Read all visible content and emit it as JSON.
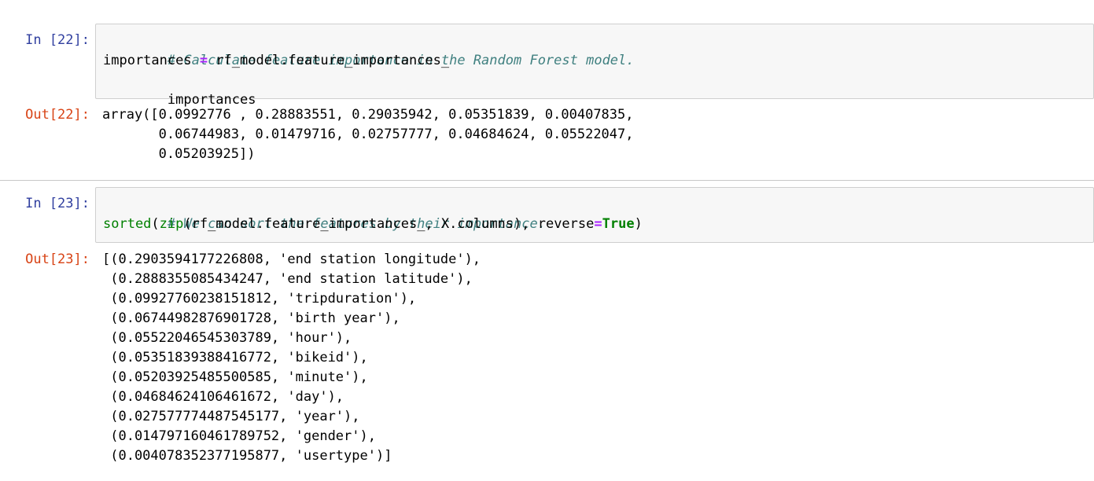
{
  "cells": [
    {
      "in_prompt": "In [22]:",
      "code": {
        "line1": "# Calculate feature importance in the Random Forest model.",
        "line2": {
          "var": "importances ",
          "op": "=",
          "rest": " rf_model.feature_importances_"
        },
        "line3": "importances"
      },
      "out_prompt": "Out[22]:",
      "output": [
        "array([0.0992776 , 0.28883551, 0.29035942, 0.05351839, 0.00407835,",
        "       0.06744983, 0.01479716, 0.02757777, 0.04684624, 0.05522047,",
        "       0.05203925])"
      ]
    },
    {
      "in_prompt": "In [23]:",
      "code": {
        "line1": "# We can sort the features by their importance.",
        "line2": {
          "fn1": "sorted",
          "p1": "(",
          "fn2": "zip",
          "mid": "(rf_model.feature_importances_, X.columns), reverse",
          "op": "=",
          "kw": "True",
          "end": ")"
        }
      },
      "out_prompt": "Out[23]:",
      "output": [
        "[(0.2903594177226808, 'end station longitude'),",
        " (0.2888355085434247, 'end station latitude'),",
        " (0.09927760238151812, 'tripduration'),",
        " (0.06744982876901728, 'birth year'),",
        " (0.05522046545303789, 'hour'),",
        " (0.05351839388416772, 'bikeid'),",
        " (0.05203925485500585, 'minute'),",
        " (0.04684624106461672, 'day'),",
        " (0.027577774487545177, 'year'),",
        " (0.014797160461789752, 'gender'),",
        " (0.004078352377195877, 'usertype')]"
      ]
    }
  ],
  "colors": {
    "in_prompt": "#303f9f",
    "out_prompt": "#d84315",
    "comment": "#408080",
    "operator": "#aa22ff",
    "builtin": "#008000",
    "input_bg": "#f7f7f7",
    "input_border": "#cfcfcf"
  }
}
